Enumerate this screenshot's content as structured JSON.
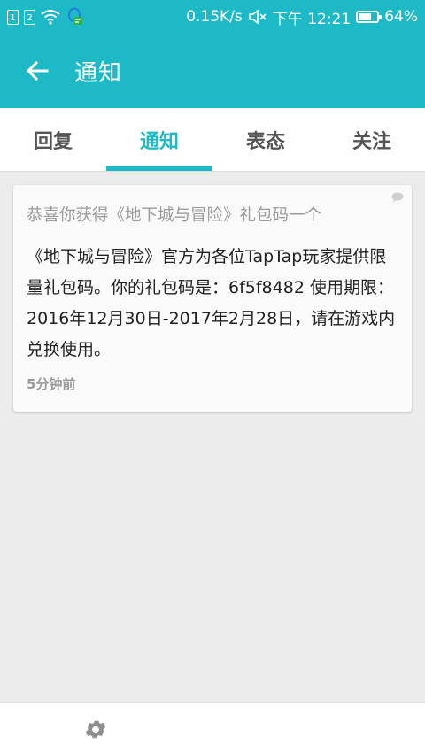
{
  "status_bar": {
    "sim1": "1",
    "sim2": "2",
    "speed": "0.15K/s",
    "time": "下午 12:21",
    "battery": "64%",
    "battery_level": 0.64
  },
  "app_bar": {
    "title": "通知"
  },
  "tabs": [
    {
      "label": "回复"
    },
    {
      "label": "通知"
    },
    {
      "label": "表态"
    },
    {
      "label": "关注"
    }
  ],
  "active_tab": "通知",
  "notification": {
    "title": "恭喜你获得《地下城与冒险》礼包码一个",
    "body": "《地下城与冒险》官方为各位TapTap玩家提供限量礼包码。你的礼包码是：6f5f8482 使用期限：2016年12月30日-2017年2月28日，请在游戏内兑换使用。",
    "time": "5分钟前"
  },
  "colors": {
    "accent": "#1eb9c6",
    "background": "#ececec"
  }
}
